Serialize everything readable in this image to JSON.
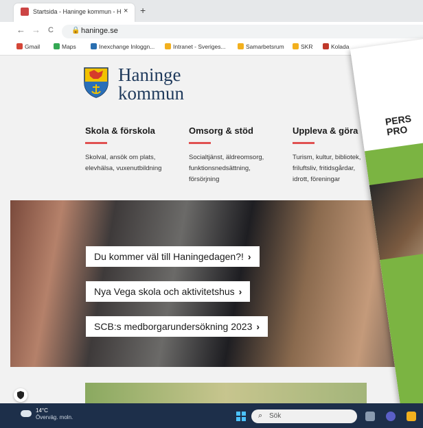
{
  "browser": {
    "tab_title": "Startsida - Haninge kommun - H",
    "tab_close": "×",
    "new_tab": "+",
    "back": "←",
    "forward": "→",
    "reload": "C",
    "lock": "🔒",
    "url": "haninge.se",
    "bookmarks": [
      {
        "label": "Gmail",
        "color": "#d44638"
      },
      {
        "label": "Maps",
        "color": "#34a853"
      },
      {
        "label": "Inexchange Inloggn...",
        "color": "#2a6fb0"
      },
      {
        "label": "Intranet - Sveriges...",
        "color": "#f2b01e"
      },
      {
        "label": "Samarbetsrum",
        "color": "#f2b01e"
      },
      {
        "label": "SKR",
        "color": "#f2b01e"
      },
      {
        "label": "Kolada",
        "color": "#c0392b"
      }
    ]
  },
  "site": {
    "logo_line1": "Haninge",
    "logo_line2": "kommun",
    "categories": [
      {
        "title": "Skola & förskola",
        "desc": [
          "Skolval, ansök om plats,",
          "elevhälsa, vuxenutbildning"
        ]
      },
      {
        "title": "Omsorg & stöd",
        "desc": [
          "Socialtjänst, äldreomsorg,",
          "funktionsnedsättning,",
          "försörjning"
        ]
      },
      {
        "title": "Uppleva & göra",
        "desc": [
          "Turism, kultur, bibliotek,",
          "friluftsliv, fritidsgårdar,",
          "idrott, föreningar"
        ]
      }
    ],
    "hero_links": [
      {
        "label": "Du kommer väl till Haningedagen?!",
        "arrow": "›"
      },
      {
        "label": "Nya Vega skola och aktivitetshus",
        "arrow": "›"
      },
      {
        "label": "SCB:s medborgarundersökning 2023",
        "arrow": "›"
      }
    ],
    "accent_color": "#e05050"
  },
  "poster": {
    "line1": "PERS",
    "line2": "PRO"
  },
  "taskbar": {
    "temperature": "14°C",
    "weather": "Överväg. moln.",
    "search_placeholder": "Sök",
    "search_icon": "⌕"
  }
}
